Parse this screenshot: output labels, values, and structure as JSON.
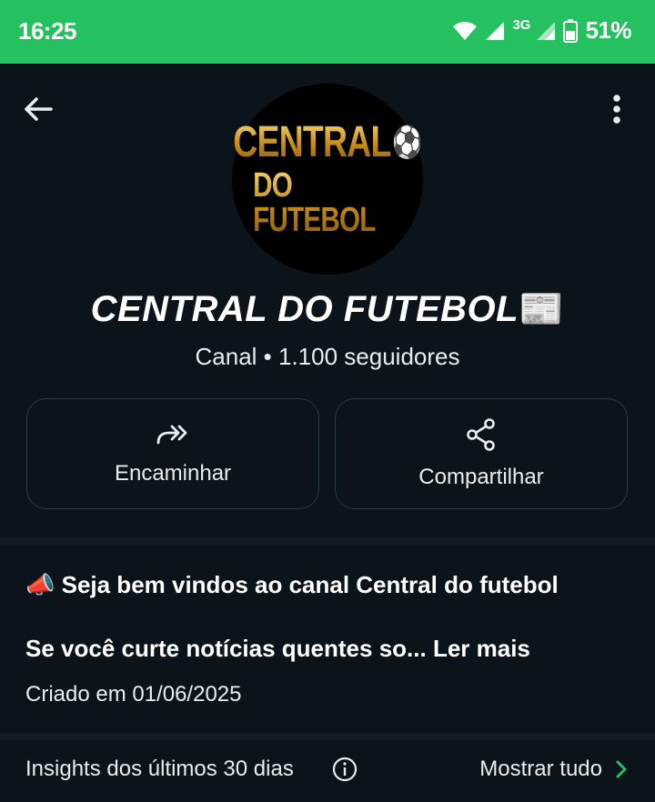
{
  "status_bar": {
    "time": "16:25",
    "network": "3G",
    "battery": "51%"
  },
  "channel": {
    "logo_line1": "CENTRAL",
    "logo_line2": "DO FUTEBOL",
    "title": "CENTRAL DO FUTEBOL",
    "title_emoji": "📰",
    "subtitle": "Canal • 1.100 seguidores"
  },
  "actions": {
    "forward_label": "Encaminhar",
    "share_label": "Compartilhar"
  },
  "description": {
    "line1": "📣 Seja bem vindos ao canal Central do futebol",
    "line2": "Se você curte notícias quentes so...",
    "read_more": " Ler mais",
    "created": "Criado em 01/06/2025"
  },
  "insights": {
    "label": "Insights dos últimos 30 dias",
    "show_all": "Mostrar tudo"
  },
  "colors": {
    "status_bar": "#25c05f",
    "background": "#0b141a",
    "accent_green": "#21c063"
  }
}
